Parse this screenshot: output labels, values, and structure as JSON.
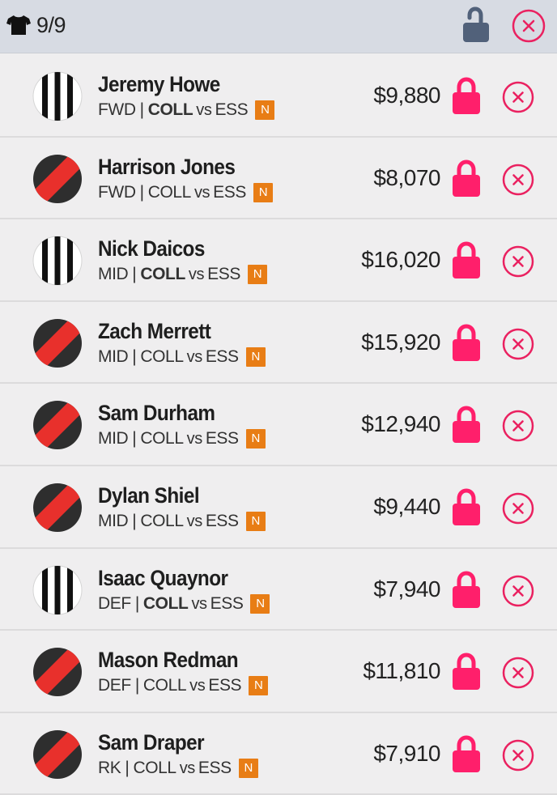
{
  "header": {
    "shirt_icon": "tshirt-icon",
    "count": "9/9",
    "lock_icon": "unlocked-padlock-icon",
    "close_icon": "close-circle-icon",
    "lock_color": "#51617a",
    "close_color": "#ea2160"
  },
  "colors": {
    "accent_pink": "#ff1f6b",
    "badge_orange": "#e87d15",
    "collingwood_black": "#111111",
    "essendon_red": "#e8302c",
    "essendon_dark": "#2e2e2e"
  },
  "players": [
    {
      "name": "Jeremy Howe",
      "position": "FWD",
      "team": "COLL",
      "team_bold": true,
      "opponent": "ESS",
      "badge": "N",
      "price": "$9,880",
      "jersey": "collingwood"
    },
    {
      "name": "Harrison Jones",
      "position": "FWD",
      "team": "COLL",
      "team_bold": false,
      "opponent": "ESS",
      "badge": "N",
      "price": "$8,070",
      "jersey": "essendon"
    },
    {
      "name": "Nick Daicos",
      "position": "MID",
      "team": "COLL",
      "team_bold": true,
      "opponent": "ESS",
      "badge": "N",
      "price": "$16,020",
      "jersey": "collingwood"
    },
    {
      "name": "Zach Merrett",
      "position": "MID",
      "team": "COLL",
      "team_bold": false,
      "opponent": "ESS",
      "badge": "N",
      "price": "$15,920",
      "jersey": "essendon"
    },
    {
      "name": "Sam Durham",
      "position": "MID",
      "team": "COLL",
      "team_bold": false,
      "opponent": "ESS",
      "badge": "N",
      "price": "$12,940",
      "jersey": "essendon"
    },
    {
      "name": "Dylan Shiel",
      "position": "MID",
      "team": "COLL",
      "team_bold": false,
      "opponent": "ESS",
      "badge": "N",
      "price": "$9,440",
      "jersey": "essendon"
    },
    {
      "name": "Isaac Quaynor",
      "position": "DEF",
      "team": "COLL",
      "team_bold": true,
      "opponent": "ESS",
      "badge": "N",
      "price": "$7,940",
      "jersey": "collingwood"
    },
    {
      "name": "Mason Redman",
      "position": "DEF",
      "team": "COLL",
      "team_bold": false,
      "opponent": "ESS",
      "badge": "N",
      "price": "$11,810",
      "jersey": "essendon"
    },
    {
      "name": "Sam Draper",
      "position": "RK",
      "team": "COLL",
      "team_bold": false,
      "opponent": "ESS",
      "badge": "N",
      "price": "$7,910",
      "jersey": "essendon"
    }
  ],
  "row_lock_icon": "locked-padlock-icon",
  "row_remove_icon": "remove-circle-icon",
  "separator": "|",
  "vs_label": "vs"
}
